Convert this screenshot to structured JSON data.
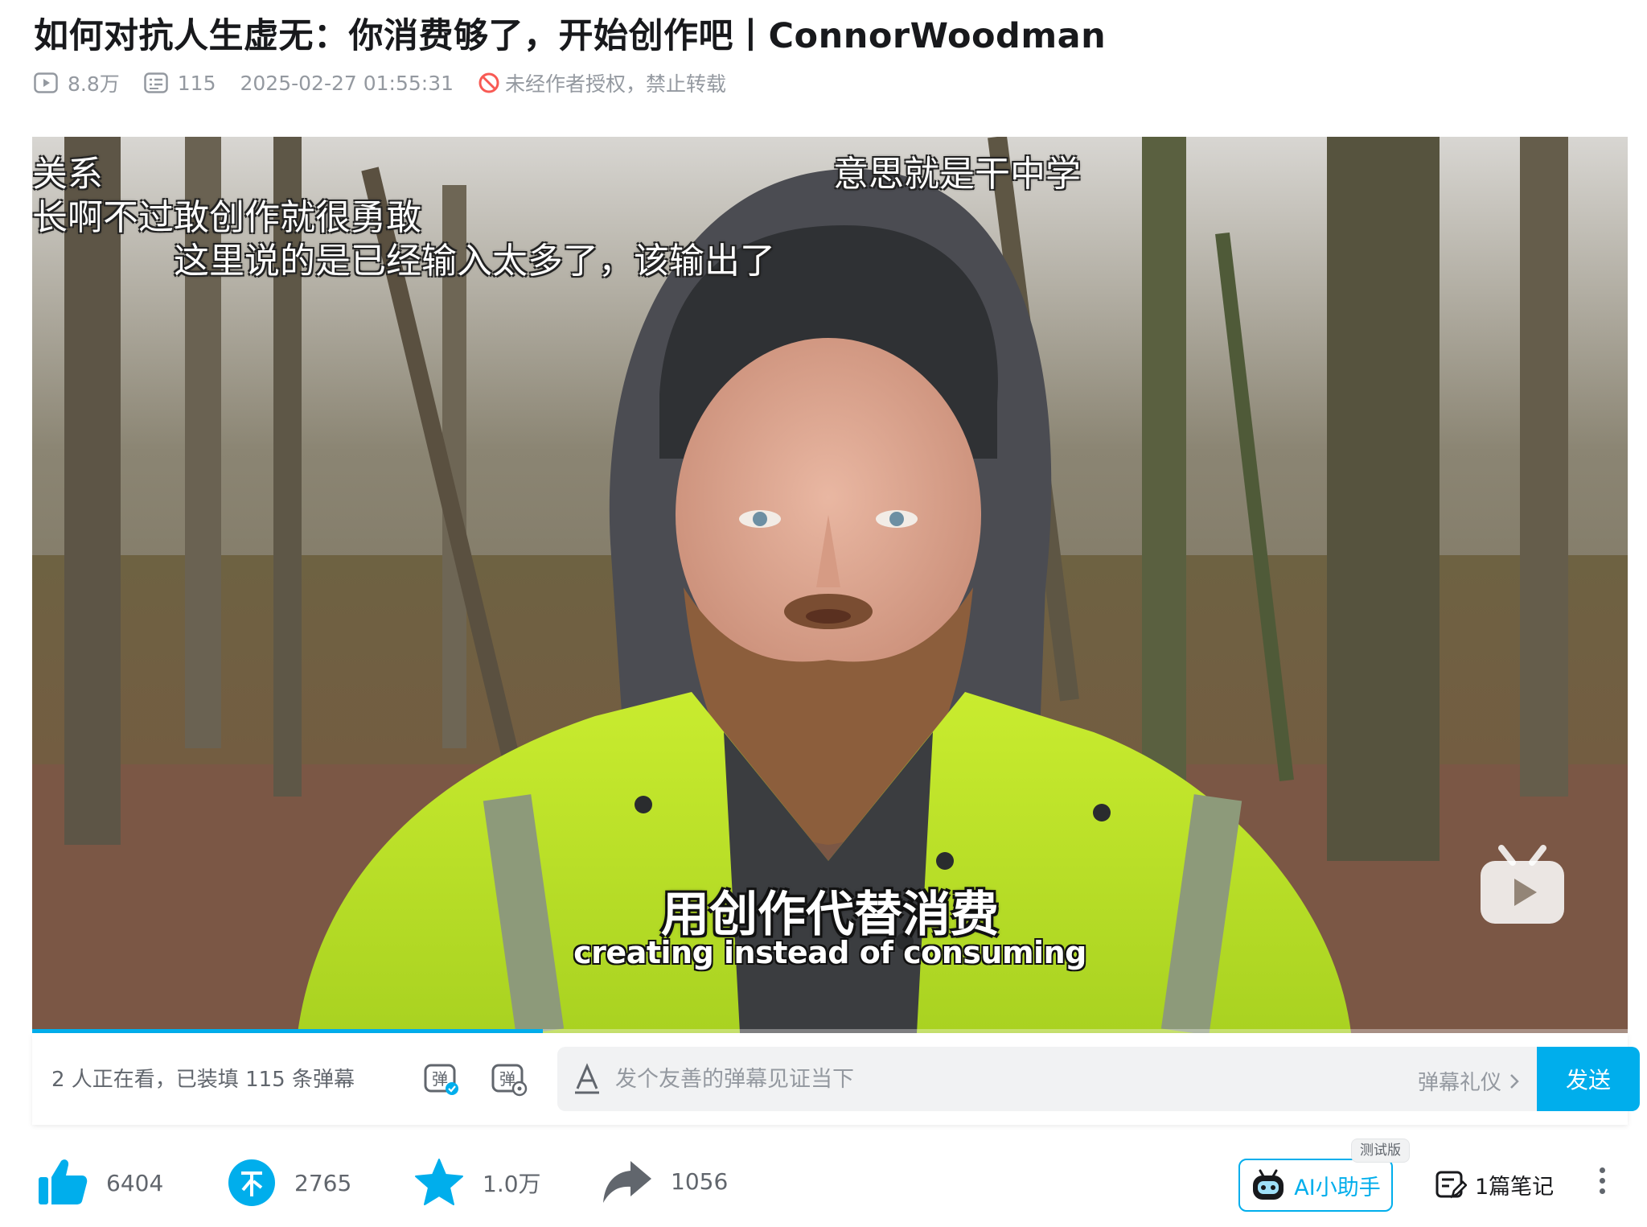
{
  "video": {
    "title": "如何对抗人生虚无：你消费够了，开始创作吧丨ConnorWoodman",
    "views": "8.8万",
    "danmaku_count": "115",
    "publish_time": "2025-02-27 01:55:31",
    "copyright_notice": "未经作者授权，禁止转载",
    "progress": 0.32
  },
  "player": {
    "danmaku_lines": [
      "关系",
      "长啊不过敢创作就很勇敢",
      "这里说的是已经输入太多了，该输出了",
      "意思就是干中学"
    ],
    "subtitle_cn": "用创作代替消费",
    "subtitle_en": "creating instead of consuming",
    "watermark_icon": "bilibili-tv-icon"
  },
  "danmaku_bar": {
    "info": "2 人正在看，已装填 115 条弹幕",
    "toggle_label": "弹",
    "settings_label": "弹",
    "input_placeholder": "发个友善的弹幕见证当下",
    "etiquette_label": "弹幕礼仪",
    "send_label": "发送"
  },
  "actions": {
    "like_count": "6404",
    "coin_count": "2765",
    "favorite_count": "1.0万",
    "share_count": "1056",
    "ai_assistant_label": "AI小助手",
    "beta_badge": "测试版",
    "notes_label": "1篇笔记"
  },
  "colors": {
    "accent": "#00aeec",
    "text_primary": "#18191c",
    "text_secondary": "#9499a0",
    "warn_red": "#f85a54"
  }
}
